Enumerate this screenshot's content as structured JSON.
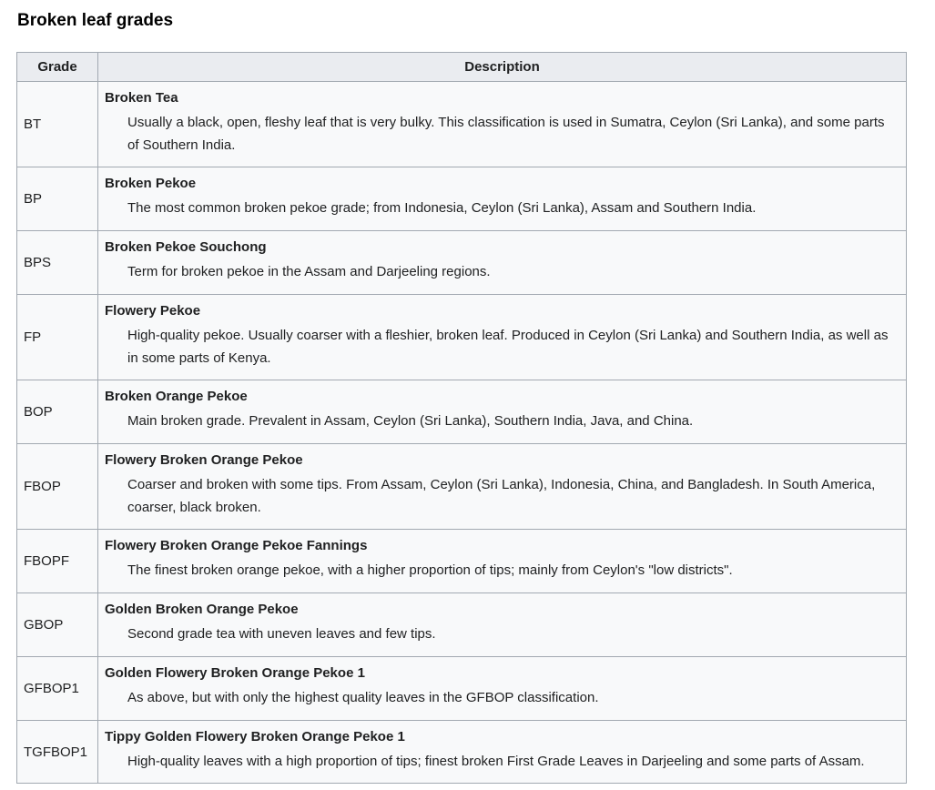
{
  "page": {
    "heading": "Broken leaf grades"
  },
  "table": {
    "headers": {
      "grade": "Grade",
      "description": "Description"
    },
    "rows": [
      {
        "grade": "BT",
        "term": "Broken Tea",
        "definition": "Usually a black, open, fleshy leaf that is very bulky. This classification is used in Sumatra, Ceylon (Sri Lanka), and some parts of Southern India."
      },
      {
        "grade": "BP",
        "term": "Broken Pekoe",
        "definition": "The most common broken pekoe grade; from Indonesia, Ceylon (Sri Lanka), Assam and Southern India."
      },
      {
        "grade": "BPS",
        "term": "Broken Pekoe Souchong",
        "definition": "Term for broken pekoe in the Assam and Darjeeling regions."
      },
      {
        "grade": "FP",
        "term": "Flowery Pekoe",
        "definition": "High-quality pekoe. Usually coarser with a fleshier, broken leaf. Produced in Ceylon (Sri Lanka) and Southern India, as well as in some parts of Kenya."
      },
      {
        "grade": "BOP",
        "term": "Broken Orange Pekoe",
        "definition": "Main broken grade. Prevalent in Assam, Ceylon (Sri Lanka), Southern India, Java, and China."
      },
      {
        "grade": "FBOP",
        "term": "Flowery Broken Orange Pekoe",
        "definition": "Coarser and broken with some tips. From Assam, Ceylon (Sri Lanka), Indonesia, China, and Bangladesh. In South America, coarser, black broken."
      },
      {
        "grade": "FBOPF",
        "term": "Flowery Broken Orange Pekoe Fannings",
        "definition": "The finest broken orange pekoe, with a higher proportion of tips; mainly from Ceylon's \"low districts\"."
      },
      {
        "grade": "GBOP",
        "term": "Golden Broken Orange Pekoe",
        "definition": "Second grade tea with uneven leaves and few tips."
      },
      {
        "grade": "GFBOP1",
        "term": "Golden Flowery Broken Orange Pekoe 1",
        "definition": "As above, but with only the highest quality leaves in the GFBOP classification."
      },
      {
        "grade": "TGFBOP1",
        "term": "Tippy Golden Flowery Broken Orange Pekoe 1",
        "definition": "High-quality leaves with a high proportion of tips; finest broken First Grade Leaves in Darjeeling and some parts of Assam."
      }
    ]
  },
  "colors": {
    "header_bg": "#eaecf0",
    "cell_bg": "#f8f9fa",
    "border": "#a2a9b1",
    "text": "#202122"
  }
}
